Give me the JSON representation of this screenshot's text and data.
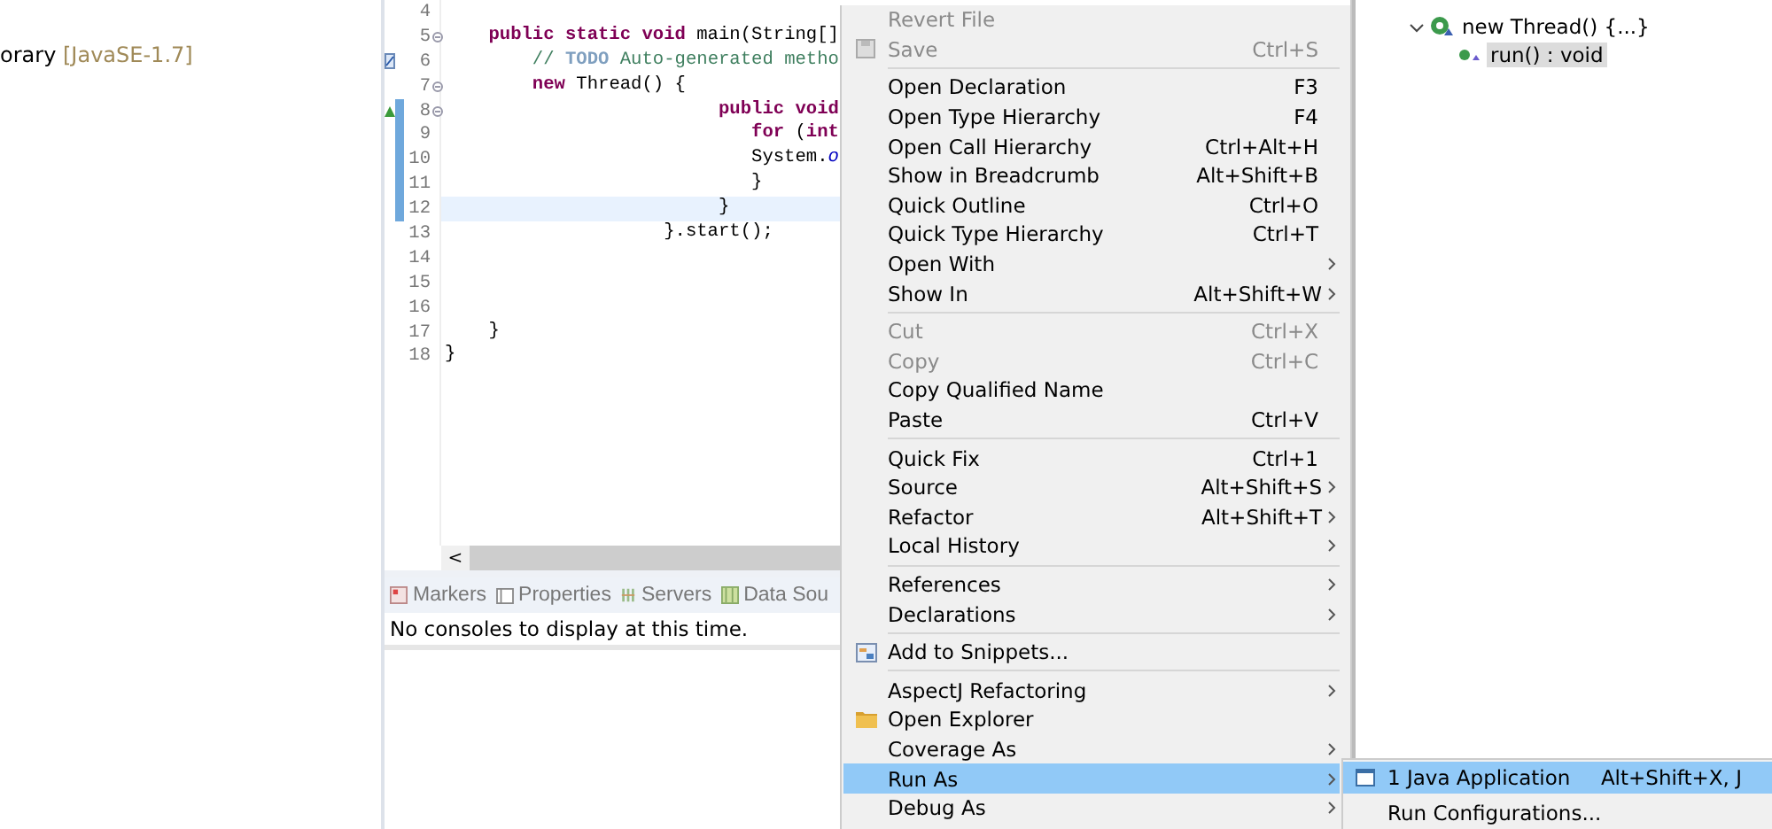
{
  "package_explorer": {
    "items": [
      {
        "label": "orary",
        "decoration": "[JavaSE-1.7]"
      }
    ]
  },
  "editor": {
    "lines": [
      {
        "number": "4",
        "fold": false,
        "changed": false,
        "current": false
      },
      {
        "number": "5",
        "fold": true,
        "changed": false,
        "current": false,
        "tokens": [
          {
            "kind": "keyword",
            "text": "    public static void"
          },
          {
            "kind": "plain",
            "text": " main(String[]"
          }
        ]
      },
      {
        "number": "6",
        "fold": false,
        "changed": false,
        "current": false,
        "tokens": [
          {
            "kind": "comment",
            "text": "        // "
          },
          {
            "kind": "todo",
            "text": "TODO"
          },
          {
            "kind": "comment",
            "text": " Auto-generated metho"
          }
        ]
      },
      {
        "number": "7",
        "fold": true,
        "changed": false,
        "current": false,
        "tokens": [
          {
            "kind": "keyword",
            "text": "        new"
          },
          {
            "kind": "plain",
            "text": " Thread() {"
          }
        ]
      },
      {
        "number": "8",
        "fold": true,
        "changed": true,
        "current": false,
        "tokens": [
          {
            "kind": "keyword",
            "text": "                         public void"
          }
        ]
      },
      {
        "number": "9",
        "fold": false,
        "changed": true,
        "current": false,
        "tokens": [
          {
            "kind": "keyword",
            "text": "                            for"
          },
          {
            "kind": "plain",
            "text": " ("
          },
          {
            "kind": "keyword",
            "text": "int"
          }
        ]
      },
      {
        "number": "10",
        "fold": false,
        "changed": true,
        "current": false,
        "tokens": [
          {
            "kind": "plain",
            "text": "                            System."
          },
          {
            "kind": "field",
            "text": "o"
          }
        ]
      },
      {
        "number": "11",
        "fold": false,
        "changed": true,
        "current": false,
        "tokens": [
          {
            "kind": "plain",
            "text": "                            }"
          }
        ]
      },
      {
        "number": "12",
        "fold": false,
        "changed": true,
        "current": true,
        "tokens": [
          {
            "kind": "plain",
            "text": "                         }"
          }
        ]
      },
      {
        "number": "13",
        "fold": false,
        "changed": false,
        "current": false,
        "tokens": [
          {
            "kind": "plain",
            "text": "                    }.start();"
          }
        ]
      },
      {
        "number": "14",
        "fold": false,
        "changed": false,
        "current": false
      },
      {
        "number": "15",
        "fold": false,
        "changed": false,
        "current": false
      },
      {
        "number": "16",
        "fold": false,
        "changed": false,
        "current": false
      },
      {
        "number": "17",
        "fold": false,
        "changed": false,
        "current": false,
        "tokens": [
          {
            "kind": "plain",
            "text": "    }"
          }
        ]
      },
      {
        "number": "18",
        "fold": false,
        "changed": false,
        "current": false,
        "tokens": [
          {
            "kind": "plain",
            "text": "}"
          }
        ]
      }
    ],
    "scroll_left": "<"
  },
  "bottom_panel": {
    "tabs": [
      {
        "label": "Markers"
      },
      {
        "label": "Properties"
      },
      {
        "label": "Servers"
      },
      {
        "label": "Data Sou"
      }
    ],
    "message": "No consoles to display at this time."
  },
  "outline": {
    "items": [
      {
        "label": "new Thread() {...}",
        "expanded": true,
        "selected": false,
        "children": [
          {
            "label": "run() : void",
            "selected": true
          }
        ]
      }
    ]
  },
  "context_menu": {
    "items": [
      {
        "kind": "item",
        "label": "Revert File",
        "disabled": true,
        "submenu": false,
        "selected": false
      },
      {
        "kind": "item",
        "label": "Save",
        "shortcut": "Ctrl+S",
        "disabled": true,
        "submenu": false,
        "selected": false
      },
      {
        "kind": "separator"
      },
      {
        "kind": "item",
        "label": "Open Declaration",
        "shortcut": "F3",
        "disabled": false,
        "submenu": false,
        "selected": false
      },
      {
        "kind": "item",
        "label": "Open Type Hierarchy",
        "shortcut": "F4",
        "disabled": false,
        "submenu": false,
        "selected": false
      },
      {
        "kind": "item",
        "label": "Open Call Hierarchy",
        "shortcut": "Ctrl+Alt+H",
        "disabled": false,
        "submenu": false,
        "selected": false
      },
      {
        "kind": "item",
        "label": "Show in Breadcrumb",
        "shortcut": "Alt+Shift+B",
        "disabled": false,
        "submenu": false,
        "selected": false
      },
      {
        "kind": "item",
        "label": "Quick Outline",
        "shortcut": "Ctrl+O",
        "disabled": false,
        "submenu": false,
        "selected": false
      },
      {
        "kind": "item",
        "label": "Quick Type Hierarchy",
        "shortcut": "Ctrl+T",
        "disabled": false,
        "submenu": false,
        "selected": false
      },
      {
        "kind": "item",
        "label": "Open With",
        "disabled": false,
        "submenu": true,
        "selected": false
      },
      {
        "kind": "item",
        "label": "Show In",
        "shortcut": "Alt+Shift+W",
        "disabled": false,
        "submenu": true,
        "selected": false
      },
      {
        "kind": "separator"
      },
      {
        "kind": "item",
        "label": "Cut",
        "shortcut": "Ctrl+X",
        "disabled": true,
        "submenu": false,
        "selected": false
      },
      {
        "kind": "item",
        "label": "Copy",
        "shortcut": "Ctrl+C",
        "disabled": true,
        "submenu": false,
        "selected": false
      },
      {
        "kind": "item",
        "label": "Copy Qualified Name",
        "disabled": false,
        "submenu": false,
        "selected": false
      },
      {
        "kind": "item",
        "label": "Paste",
        "shortcut": "Ctrl+V",
        "disabled": false,
        "submenu": false,
        "selected": false
      },
      {
        "kind": "separator"
      },
      {
        "kind": "item",
        "label": "Quick Fix",
        "shortcut": "Ctrl+1",
        "disabled": false,
        "submenu": false,
        "selected": false
      },
      {
        "kind": "item",
        "label": "Source",
        "shortcut": "Alt+Shift+S",
        "disabled": false,
        "submenu": true,
        "selected": false
      },
      {
        "kind": "item",
        "label": "Refactor",
        "shortcut": "Alt+Shift+T",
        "disabled": false,
        "submenu": true,
        "selected": false
      },
      {
        "kind": "item",
        "label": "Local History",
        "disabled": false,
        "submenu": true,
        "selected": false
      },
      {
        "kind": "separator"
      },
      {
        "kind": "item",
        "label": "References",
        "disabled": false,
        "submenu": true,
        "selected": false
      },
      {
        "kind": "item",
        "label": "Declarations",
        "disabled": false,
        "submenu": true,
        "selected": false
      },
      {
        "kind": "separator"
      },
      {
        "kind": "item",
        "label": "Add to Snippets...",
        "disabled": false,
        "submenu": false,
        "selected": false
      },
      {
        "kind": "separator"
      },
      {
        "kind": "item",
        "label": "AspectJ Refactoring",
        "disabled": false,
        "submenu": true,
        "selected": false
      },
      {
        "kind": "item",
        "label": "Open Explorer",
        "disabled": false,
        "submenu": false,
        "selected": false
      },
      {
        "kind": "item",
        "label": "Coverage As",
        "disabled": false,
        "submenu": true,
        "selected": false
      },
      {
        "kind": "item",
        "label": "Run As",
        "disabled": false,
        "submenu": true,
        "selected": true
      },
      {
        "kind": "item",
        "label": "Debug As",
        "disabled": false,
        "submenu": true,
        "selected": false
      }
    ]
  },
  "submenu": {
    "items": [
      {
        "label": "1 Java Application",
        "shortcut": "Alt+Shift+X, J",
        "selected": true
      },
      {
        "label": "Run Configurations...",
        "selected": false
      }
    ]
  }
}
